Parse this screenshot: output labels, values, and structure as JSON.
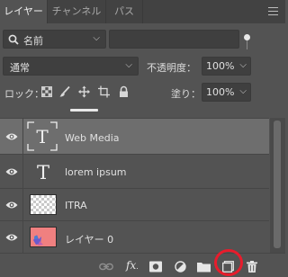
{
  "tabs": [
    {
      "label": "レイヤー",
      "active": true
    },
    {
      "label": "チャンネル",
      "active": false
    },
    {
      "label": "パス",
      "active": false
    }
  ],
  "filter": {
    "kind_label": "名前",
    "search_value": ""
  },
  "blend": {
    "mode": "通常",
    "opacity_label": "不透明度：",
    "opacity_value": "100%"
  },
  "lock": {
    "label": "ロック：",
    "fill_label": "塗り：",
    "fill_value": "100%"
  },
  "layers": [
    {
      "name": "Web Media",
      "kind": "text",
      "selected": true,
      "visible": true
    },
    {
      "name": "lorem ipsum",
      "kind": "text",
      "selected": false,
      "visible": true
    },
    {
      "name": "ITRA",
      "kind": "transparent",
      "selected": false,
      "visible": true
    },
    {
      "name": "レイヤー 0",
      "kind": "image",
      "selected": false,
      "visible": true
    }
  ],
  "bottom_icons": [
    "link-icon",
    "fx-icon",
    "mask-icon",
    "adjustment-icon",
    "folder-icon",
    "new-layer-icon",
    "trash-icon"
  ],
  "colors": {
    "panel": "#535353",
    "tabbar": "#424242",
    "selected_row": "#6e6e6e",
    "highlight_circle": "#e81c2c",
    "thumb_pink": "#f08080"
  }
}
